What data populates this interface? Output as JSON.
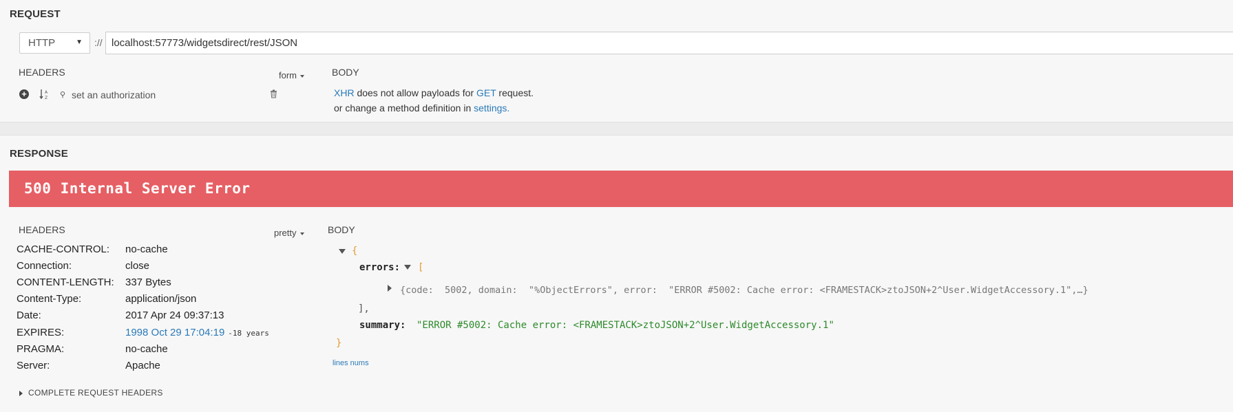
{
  "request": {
    "title": "REQUEST",
    "method": "HTTP",
    "protocol_separator": "://",
    "url": "localhost:57773/widgetsdirect/rest/JSON",
    "headers_label": "HEADERS",
    "headers_format": "form",
    "auth_placeholder": "set an authorization",
    "body_label": "BODY",
    "body_msg": {
      "xhr": "XHR",
      "text1": " does not allow payloads for ",
      "method": "GET",
      "text2": " request.",
      "line2": "or change a method definition in ",
      "settings": "settings."
    }
  },
  "response": {
    "title": "RESPONSE",
    "status": "500 Internal Server Error",
    "headers_label": "HEADERS",
    "headers_format": "pretty",
    "body_label": "BODY",
    "headers": [
      {
        "key": "CACHE-CONTROL:",
        "value": "no-cache"
      },
      {
        "key": "Connection:",
        "value": "close"
      },
      {
        "key": "CONTENT-LENGTH:",
        "value": "337 Bytes"
      },
      {
        "key": "Content-Type:",
        "value": "application/json"
      },
      {
        "key": "Date:",
        "value": "2017 Apr 24 09:37:13"
      },
      {
        "key": "EXPIRES:",
        "value": "1998 Oct 29 17:04:19",
        "relative": "-18 years"
      },
      {
        "key": "PRAGMA:",
        "value": "no-cache"
      },
      {
        "key": "Server:",
        "value": "Apache"
      }
    ],
    "complete_headers_label": "COMPLETE REQUEST HEADERS",
    "json": {
      "open_brace": "{",
      "errors_key": "errors:",
      "open_bracket": "[",
      "collapsed_item": "{code:  5002, domain:  \"%ObjectErrors\", error:  \"ERROR #5002: Cache error: <FRAMESTACK>ztoJSON+2^User.WidgetAccessory.1\",…}",
      "close_bracket": "],",
      "summary_key": "summary:",
      "summary_value": "\"ERROR #5002: Cache error: <FRAMESTACK>ztoJSON+2^User.WidgetAccessory.1\"",
      "close_brace": "}"
    },
    "lines_nums_label": "lines nums"
  },
  "colors": {
    "error_banner": "#e65f64",
    "link": "#2a7ab8",
    "json_string": "#2d8a2a",
    "json_brace": "#e39b34"
  }
}
